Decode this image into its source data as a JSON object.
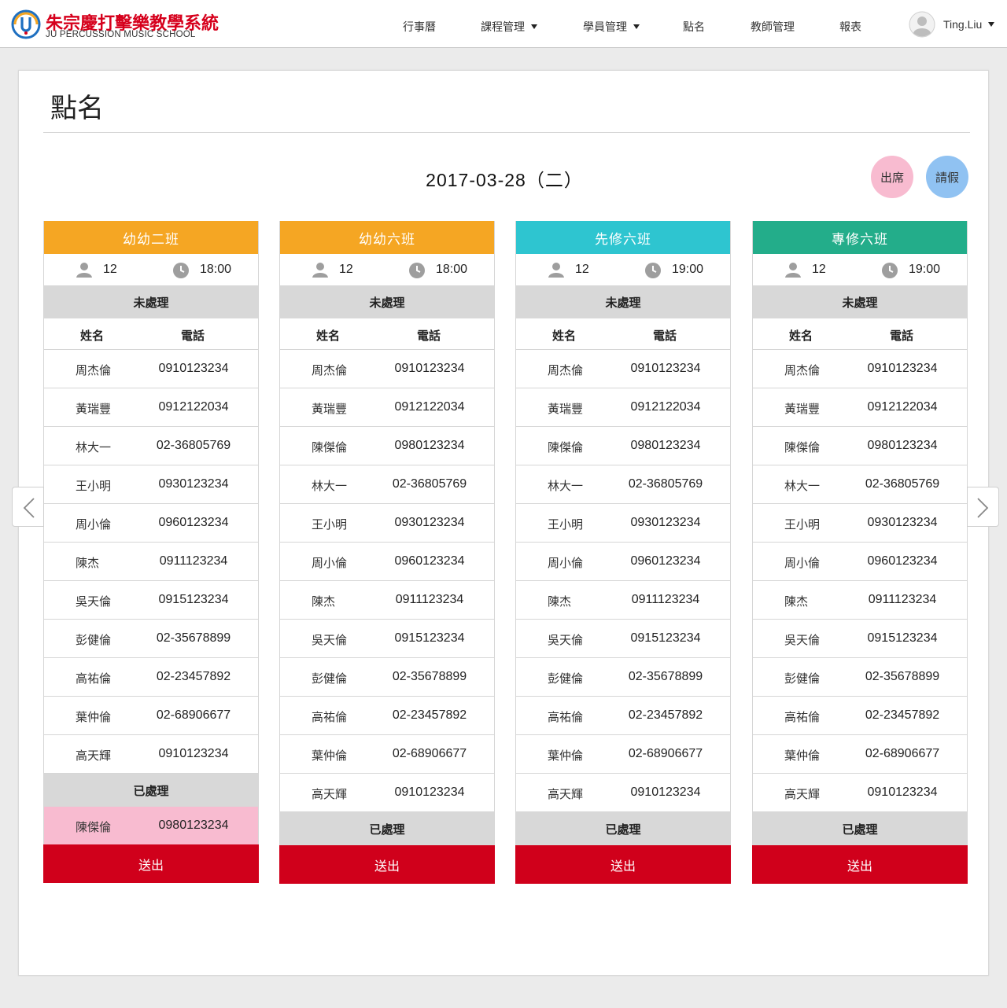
{
  "app": {
    "logo_cn": "朱宗慶打擊樂教學系統",
    "logo_en": "JU PERCUSSION MUSIC SCHOOL"
  },
  "nav": {
    "items": [
      {
        "label": "行事曆",
        "dropdown": false
      },
      {
        "label": "課程管理",
        "dropdown": true
      },
      {
        "label": "學員管理",
        "dropdown": true
      },
      {
        "label": "點名",
        "dropdown": false
      },
      {
        "label": "教師管理",
        "dropdown": false
      },
      {
        "label": "報表",
        "dropdown": false
      }
    ],
    "user": "Ting.Liu"
  },
  "page": {
    "title": "點名",
    "date": "2017-03-28（二）",
    "legend": {
      "attend": "出席",
      "leave": "請假"
    }
  },
  "colors": {
    "orange": "#f5a623",
    "cyan": "#2ec5d0",
    "green": "#23ad8a",
    "submit": "#d0001b",
    "attend": "#f8bbd0",
    "leave": "#90c2f2"
  },
  "labels": {
    "pending": "未處理",
    "processed": "已處理",
    "name_header": "姓名",
    "phone_header": "電話",
    "submit": "送出"
  },
  "classes": [
    {
      "name": "幼幼二班",
      "color": "#f5a623",
      "count": "12",
      "time": "18:00",
      "pending": [
        {
          "name": "周杰倫",
          "phone": "0910123234"
        },
        {
          "name": "黃瑞豐",
          "phone": "0912122034"
        },
        {
          "name": "林大一",
          "phone": "02-36805769"
        },
        {
          "name": "王小明",
          "phone": "0930123234"
        },
        {
          "name": "周小倫",
          "phone": "0960123234"
        },
        {
          "name": "陳杰",
          "phone": "0911123234"
        },
        {
          "name": "吳天倫",
          "phone": "0915123234"
        },
        {
          "name": "彭健倫",
          "phone": "02-35678899"
        },
        {
          "name": "高祐倫",
          "phone": "02-23457892"
        },
        {
          "name": "葉仲倫",
          "phone": "02-68906677"
        },
        {
          "name": "高天輝",
          "phone": "0910123234"
        }
      ],
      "processed": [
        {
          "name": "陳傑倫",
          "phone": "0980123234",
          "status": "attend"
        }
      ]
    },
    {
      "name": "幼幼六班",
      "color": "#f5a623",
      "count": "12",
      "time": "18:00",
      "pending": [
        {
          "name": "周杰倫",
          "phone": "0910123234"
        },
        {
          "name": "黃瑞豐",
          "phone": "0912122034"
        },
        {
          "name": "陳傑倫",
          "phone": "0980123234"
        },
        {
          "name": "林大一",
          "phone": "02-36805769"
        },
        {
          "name": "王小明",
          "phone": "0930123234"
        },
        {
          "name": "周小倫",
          "phone": "0960123234"
        },
        {
          "name": "陳杰",
          "phone": "0911123234"
        },
        {
          "name": "吳天倫",
          "phone": "0915123234"
        },
        {
          "name": "彭健倫",
          "phone": "02-35678899"
        },
        {
          "name": "高祐倫",
          "phone": "02-23457892"
        },
        {
          "name": "葉仲倫",
          "phone": "02-68906677"
        },
        {
          "name": "高天輝",
          "phone": "0910123234"
        }
      ],
      "processed": []
    },
    {
      "name": "先修六班",
      "color": "#2ec5d0",
      "count": "12",
      "time": "19:00",
      "pending": [
        {
          "name": "周杰倫",
          "phone": "0910123234"
        },
        {
          "name": "黃瑞豐",
          "phone": "0912122034"
        },
        {
          "name": "陳傑倫",
          "phone": "0980123234"
        },
        {
          "name": "林大一",
          "phone": "02-36805769"
        },
        {
          "name": "王小明",
          "phone": "0930123234"
        },
        {
          "name": "周小倫",
          "phone": "0960123234"
        },
        {
          "name": "陳杰",
          "phone": "0911123234"
        },
        {
          "name": "吳天倫",
          "phone": "0915123234"
        },
        {
          "name": "彭健倫",
          "phone": "02-35678899"
        },
        {
          "name": "高祐倫",
          "phone": "02-23457892"
        },
        {
          "name": "葉仲倫",
          "phone": "02-68906677"
        },
        {
          "name": "高天輝",
          "phone": "0910123234"
        }
      ],
      "processed": []
    },
    {
      "name": "專修六班",
      "color": "#23ad8a",
      "count": "12",
      "time": "19:00",
      "pending": [
        {
          "name": "周杰倫",
          "phone": "0910123234"
        },
        {
          "name": "黃瑞豐",
          "phone": "0912122034"
        },
        {
          "name": "陳傑倫",
          "phone": "0980123234"
        },
        {
          "name": "林大一",
          "phone": "02-36805769"
        },
        {
          "name": "王小明",
          "phone": "0930123234"
        },
        {
          "name": "周小倫",
          "phone": "0960123234"
        },
        {
          "name": "陳杰",
          "phone": "0911123234"
        },
        {
          "name": "吳天倫",
          "phone": "0915123234"
        },
        {
          "name": "彭健倫",
          "phone": "02-35678899"
        },
        {
          "name": "高祐倫",
          "phone": "02-23457892"
        },
        {
          "name": "葉仲倫",
          "phone": "02-68906677"
        },
        {
          "name": "高天輝",
          "phone": "0910123234"
        }
      ],
      "processed": []
    }
  ]
}
